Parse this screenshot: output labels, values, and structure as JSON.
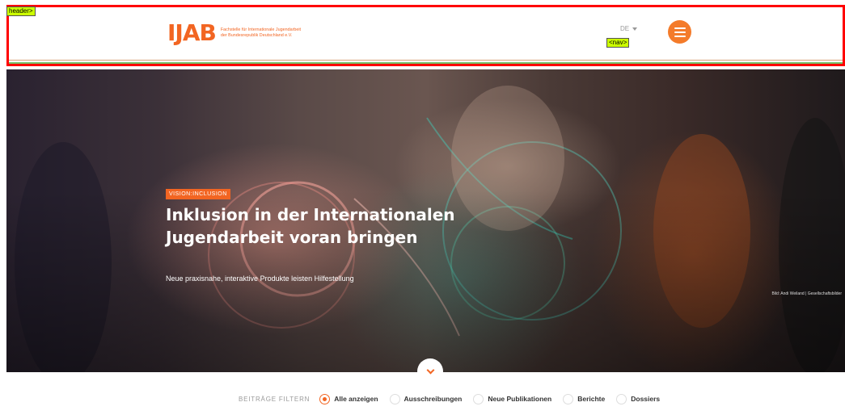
{
  "debug": {
    "header_tag": "header>",
    "nav_tag": "<nav>"
  },
  "header": {
    "logo_mark": "IJAB",
    "logo_line1": "Fachstelle für Internationale Jugendarbeit",
    "logo_line2": "der Bundesrepublik Deutschland e.V.",
    "lang_label": "DE",
    "menu_icon": "hamburger-icon",
    "brand_color": "#f26522"
  },
  "hero": {
    "kicker": "VISION:INCLUSION",
    "title": "Inklusion in der Internationalen Jugendarbeit voran bringen",
    "subtitle": "Neue praxisnahe, interaktive Produkte leisten Hilfestellung",
    "credit": "Bild: Andi Weiland | Gesellschaftsbilder",
    "scroll_icon": "chevron-down-icon"
  },
  "filter": {
    "label": "BEITRÄGE FILTERN",
    "options": [
      {
        "label": "Alle anzeigen",
        "selected": true
      },
      {
        "label": "Ausschreibungen",
        "selected": false
      },
      {
        "label": "Neue Publikationen",
        "selected": false
      },
      {
        "label": "Berichte",
        "selected": false
      },
      {
        "label": "Dossiers",
        "selected": false
      }
    ]
  }
}
